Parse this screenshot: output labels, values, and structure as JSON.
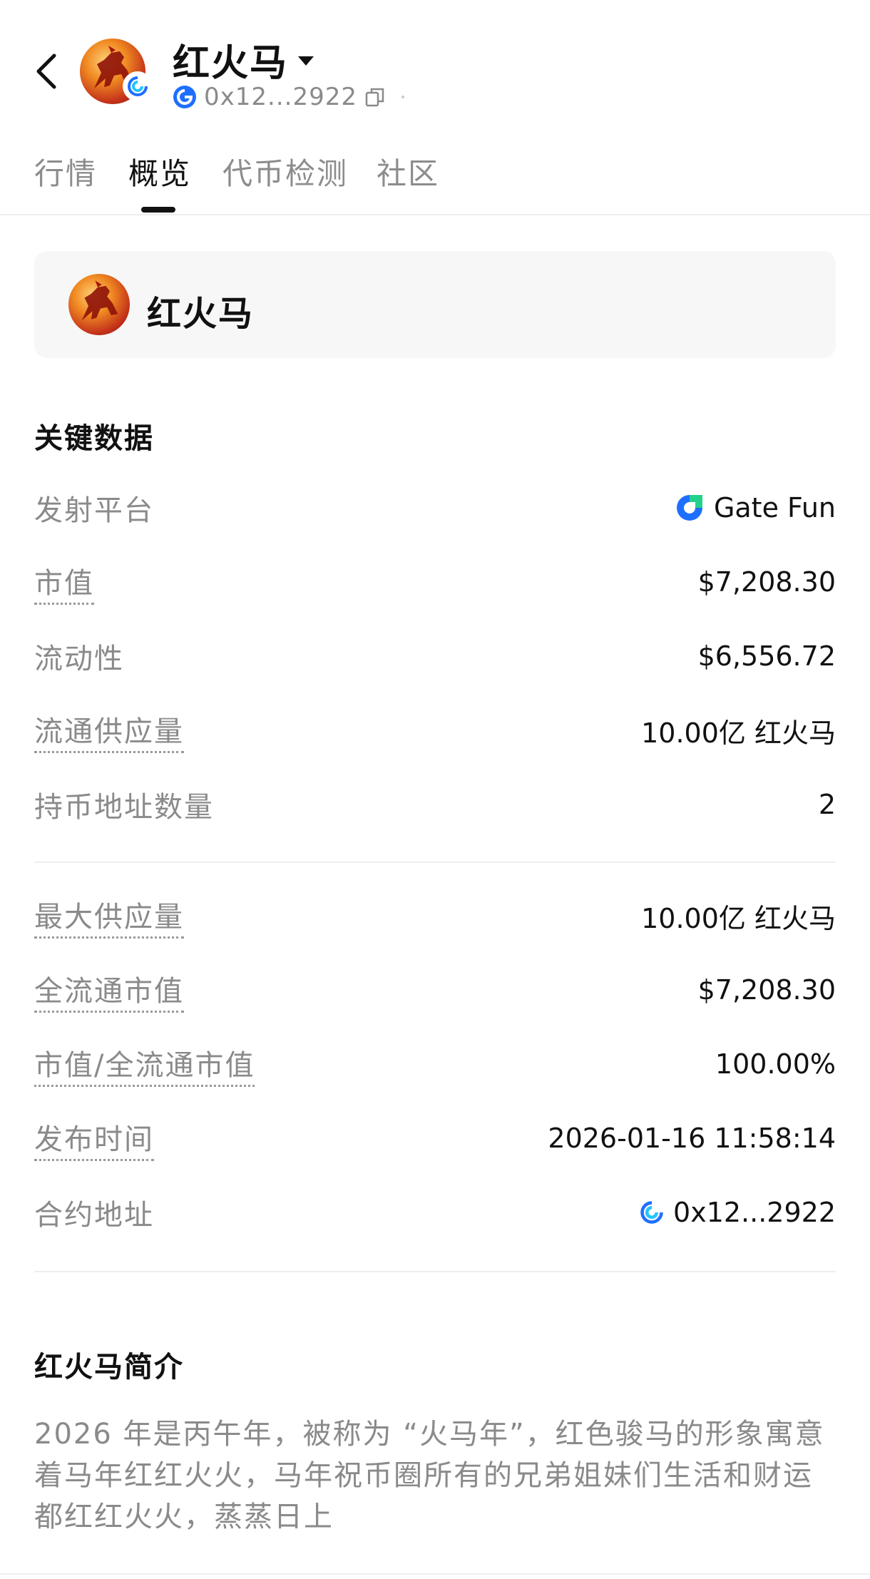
{
  "header": {
    "title": "红火马",
    "address_short": "0x12...2922",
    "back_icon": "chevron-left-icon",
    "copy_icon": "copy-icon",
    "chain_icon": "gate-chain-icon"
  },
  "tabs": [
    {
      "label": "行情",
      "active": false
    },
    {
      "label": "概览",
      "active": true
    },
    {
      "label": "代币检测",
      "active": false
    },
    {
      "label": "社区",
      "active": false
    }
  ],
  "token_card": {
    "name": "红火马"
  },
  "key_data": {
    "title": "关键数据",
    "platform": {
      "label": "发射平台",
      "value": "Gate Fun",
      "icon": "gate-fun-logo-icon"
    },
    "market_cap": {
      "label": "市值",
      "value": "$7,208.30"
    },
    "liquidity": {
      "label": "流动性",
      "value": "$6,556.72"
    },
    "circulating_supply": {
      "label": "流通供应量",
      "value": "10.00亿 红火马"
    },
    "holders": {
      "label": "持币地址数量",
      "value": "2"
    },
    "max_supply": {
      "label": "最大供应量",
      "value": "10.00亿 红火马"
    },
    "fdv": {
      "label": "全流通市值",
      "value": "$7,208.30"
    },
    "mc_fdv": {
      "label": "市值/全流通市值",
      "value": "100.00%"
    },
    "launch_time": {
      "label": "发布时间",
      "value": "2026-01-16 11:58:14"
    },
    "contract": {
      "label": "合约地址",
      "value": "0x12...2922",
      "icon": "gate-chain-icon"
    }
  },
  "intro": {
    "title": "红火马简介",
    "text": "2026 年是丙午年，被称为 “火马年”，红色骏马的形象寓意着马年红红火火，马年祝币圈所有的兄弟姐妹们生活和财运都红红火火，蒸蒸日上"
  },
  "colors": {
    "accent": "#1e6fff",
    "muted": "#8a8a8a",
    "text": "#111111"
  }
}
